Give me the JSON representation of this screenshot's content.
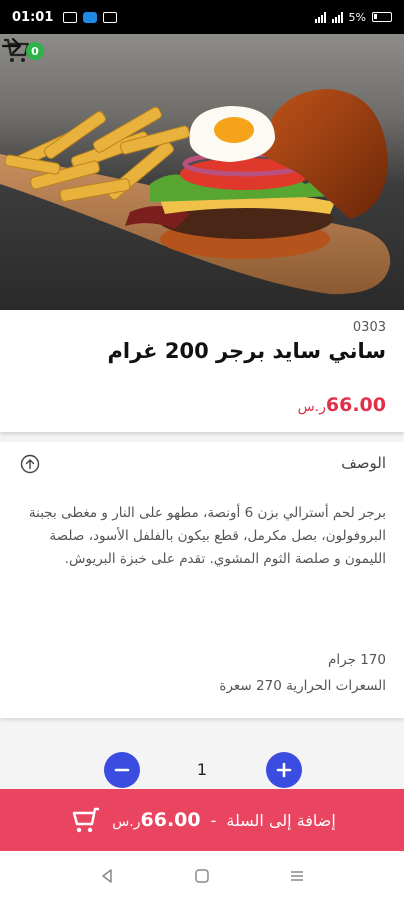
{
  "status_bar": {
    "time": "01:01",
    "battery": "5%"
  },
  "header": {
    "cart_count": "0"
  },
  "product": {
    "sku": "0303",
    "title": "ساني سايد برجر 200 غرام",
    "price": "66.00",
    "currency": "ر.س"
  },
  "description": {
    "heading": "الوصف",
    "text": "برجر لحم أسترالي بزن 6 أونصة، مطهو على النار و مغطى بجبنة البروفولون، بصل مكرمل، قطع بيكون بالفلفل الأسود، صلصة الليمون و صلصة الثوم المشوي. تقدم على خبزة البريوش.",
    "weight": "170 جرام",
    "calories": "السعرات الحرارية 270 سعرة"
  },
  "quantity": {
    "value": "1"
  },
  "add_to_cart": {
    "label": "إضافة إلى السلة",
    "separator": "-",
    "price": "66.00",
    "currency": "ر.س"
  },
  "colors": {
    "accent": "#ea4560",
    "price": "#e2304a",
    "qty_button": "#3b4de0",
    "badge": "#2fb24a"
  },
  "icons": [
    "cart-icon",
    "arrow-right-icon",
    "arrow-up-circle-icon",
    "minus-icon",
    "plus-icon",
    "back-icon",
    "home-icon",
    "recents-icon"
  ]
}
